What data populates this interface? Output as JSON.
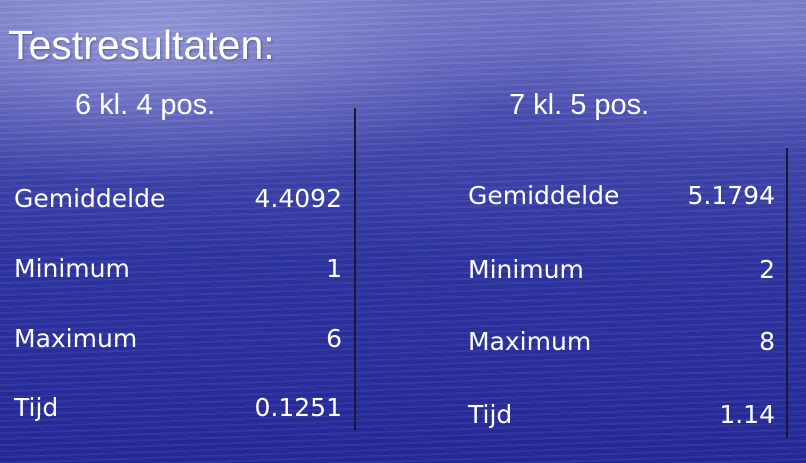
{
  "title": "Testresultaten:",
  "left": {
    "heading": "6 kl. 4 pos.",
    "rows": [
      {
        "label": "Gemiddelde",
        "value": "4.4092"
      },
      {
        "label": "Minimum",
        "value": "1"
      },
      {
        "label": "Maximum",
        "value": "6"
      },
      {
        "label": "Tijd",
        "value": "0.1251"
      }
    ]
  },
  "right": {
    "heading": "7 kl. 5 pos.",
    "rows": [
      {
        "label": "Gemiddelde",
        "value": "5.1794"
      },
      {
        "label": "Minimum",
        "value": "2"
      },
      {
        "label": "Maximum",
        "value": "8"
      },
      {
        "label": "Tijd",
        "value": "1.14"
      }
    ]
  }
}
